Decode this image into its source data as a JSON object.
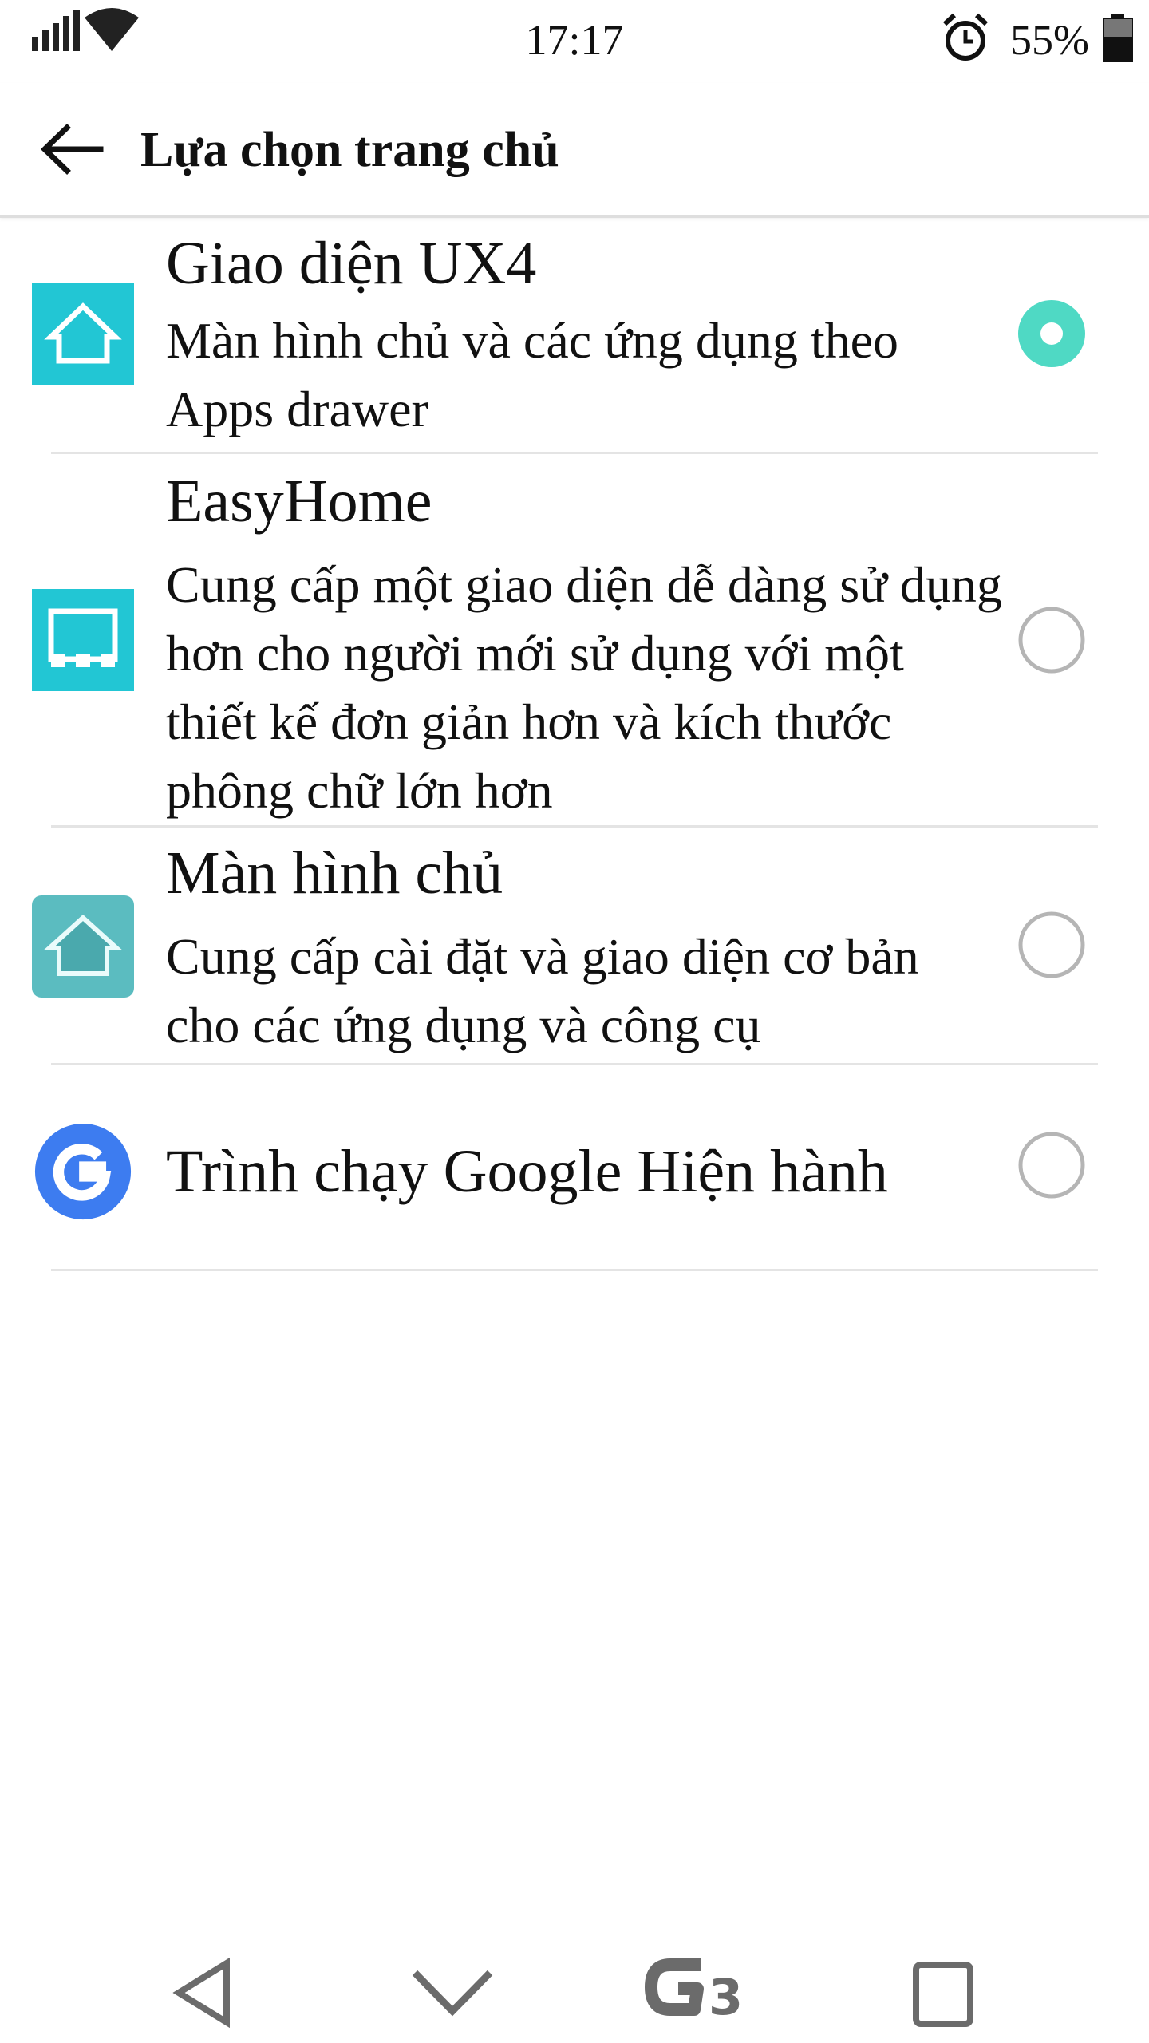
{
  "status_bar": {
    "time": "17:17",
    "battery_percent": "55%",
    "icons": [
      "signal-icon",
      "wifi-icon",
      "alarm-icon",
      "battery-icon"
    ]
  },
  "app_bar": {
    "title": "Lựa chọn trang chủ",
    "back_icon": "arrow-left-icon"
  },
  "launchers": [
    {
      "title": "Giao diện UX4",
      "description": "Màn hình chủ và các ứng dụng theo Apps drawer",
      "icon": "home-icon",
      "selected": true
    },
    {
      "title": "EasyHome",
      "description": "Cung cấp một giao diện dễ dàng sử dụng hơn cho người mới sử dụng với một thiết kế đơn giản hơn và kích thước phông chữ lớn hơn",
      "icon": "easyhome-icon",
      "selected": false
    },
    {
      "title": "Màn hình chủ",
      "description": "Cung cấp cài đặt và giao diện cơ bản cho các ứng dụng và công cụ",
      "icon": "home-icon",
      "selected": false
    },
    {
      "title": "Trình chạy Google Hiện hành",
      "description": "",
      "icon": "google-icon",
      "selected": false
    }
  ],
  "nav_bar": {
    "items": [
      "back-icon",
      "notification-down-icon",
      "g3-home-icon",
      "recents-icon"
    ],
    "home_label": "G3"
  },
  "colors": {
    "accent": "#4fd9c4",
    "icon_teal": "#22c6d4",
    "icon_teal_dark": "#5bbcc0",
    "google_blue": "#3d7cf0",
    "radio_off": "#b5b5b5",
    "divider": "#e4e4e4"
  }
}
